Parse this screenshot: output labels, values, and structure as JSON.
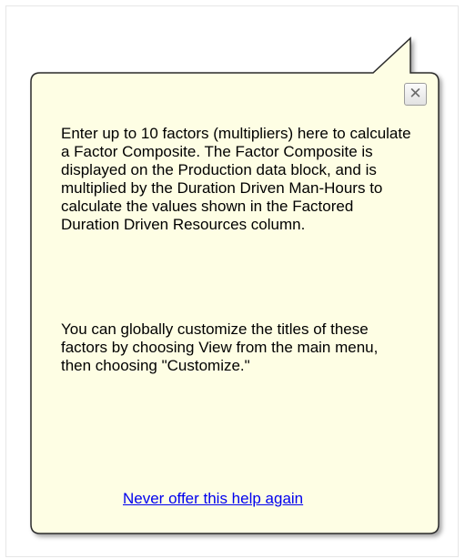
{
  "balloon": {
    "paragraphs": [
      "Enter up to 10 factors (multipliers) here to calculate a Factor Composite. The Factor Composite is displayed on the Production data block, and is multiplied by the Duration Driven Man-Hours to calculate the values shown in the Factored Duration Driven Resources column.",
      "You can globally customize the titles of these factors by choosing View from the main menu, then choosing \"Customize.\""
    ],
    "dismiss_link": "Never offer this help again",
    "close_glyph": "✕",
    "close_icon": "close-icon"
  },
  "colors": {
    "balloon_fill": "#fefee4",
    "balloon_border": "#2a2a2a",
    "link": "#0000ee"
  }
}
